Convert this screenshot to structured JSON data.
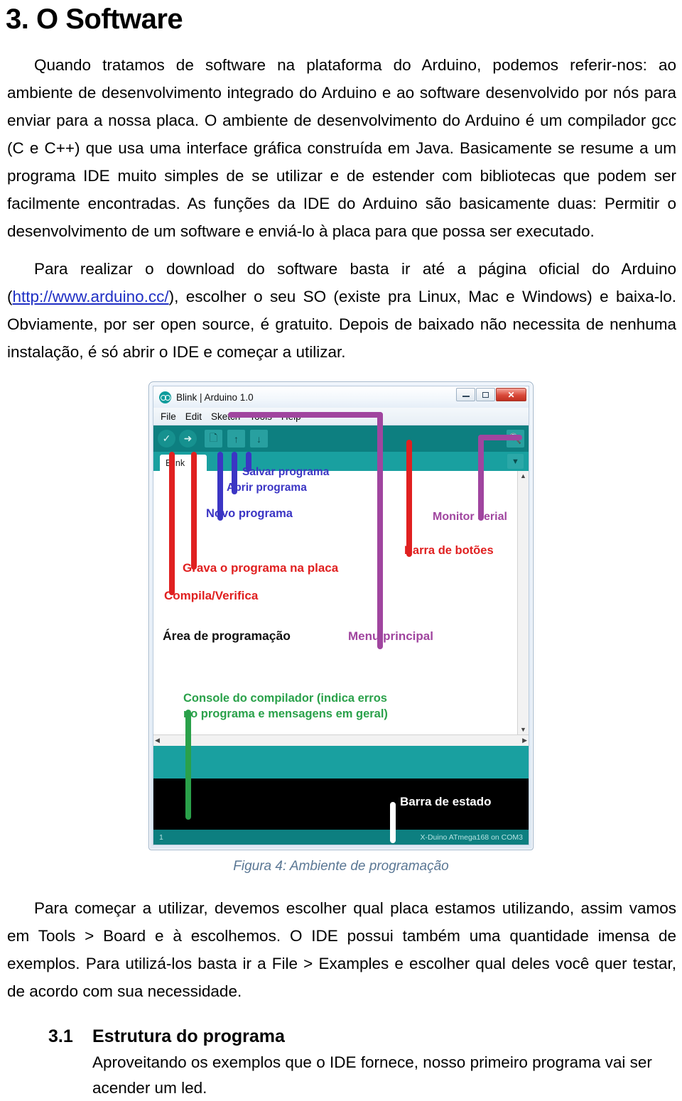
{
  "heading": "3. O Software",
  "paragraphs": {
    "p1": "Quando tratamos de software na plataforma do Arduino, podemos referir-nos: ao ambiente de desenvolvimento integrado do Arduino e ao software desenvolvido por nós para enviar para a nossa placa. O ambiente de desenvolvimento do Arduino é um compilador gcc (C e C++) que usa uma interface gráfica construída em Java. Basicamente se resume a um programa IDE muito simples de se utilizar e de estender com bibliotecas que podem ser facilmente encontradas. As funções da IDE do Arduino são basicamente duas: Permitir o desenvolvimento de um software e enviá-lo à placa para que possa ser executado.",
    "p2_before_link": "Para realizar o download do software basta ir até a página oficial do Arduino (",
    "p2_link": "http://www.arduino.cc/",
    "p2_after_link": "), escolher o seu SO (existe pra Linux, Mac e Windows) e baixa-lo. Obviamente, por ser open source, é gratuito.  Depois de baixado não necessita de nenhuma instalação, é só abrir o IDE e começar a utilizar.",
    "p3": "Para começar a utilizar, devemos escolher qual placa estamos utilizando, assim vamos em Tools > Board e à escolhemos. O IDE possui também uma quantidade imensa de exemplos. Para utilizá-los basta ir a File > Examples e escolher qual deles você quer testar, de acordo com sua necessidade."
  },
  "figure": {
    "caption": "Figura 4: Ambiente de programação",
    "ide": {
      "title": "Blink | Arduino 1.0",
      "logo_icon": "arduino-infinity-logo-icon",
      "window_buttons": {
        "minimize": "minimize-icon",
        "maximize": "maximize-icon",
        "close": "✕"
      },
      "menu": [
        "File",
        "Edit",
        "Sketch",
        "Tools",
        "Help"
      ],
      "toolbar": [
        {
          "name": "verify",
          "icon": "✓"
        },
        {
          "name": "upload",
          "icon": "➜"
        },
        {
          "name": "new",
          "icon": "🗋"
        },
        {
          "name": "open",
          "icon": "↑"
        },
        {
          "name": "save",
          "icon": "↓"
        },
        {
          "name": "serial-monitor",
          "icon": "🔍"
        }
      ],
      "tab_label": "Blink",
      "tab_dropdown_icon": "▼",
      "status_left": "1",
      "status_right": "X-Duino ATmega168 on COM3"
    },
    "annotations": [
      {
        "text": "Salvar programa",
        "color": "blue"
      },
      {
        "text": "Abrir programa",
        "color": "blue"
      },
      {
        "text": "Novo programa",
        "color": "blue"
      },
      {
        "text": "Monitor serial",
        "color": "purple"
      },
      {
        "text": "Barra de botões",
        "color": "red"
      },
      {
        "text": "Grava o programa na placa",
        "color": "red"
      },
      {
        "text": "Compila/Verifica",
        "color": "red"
      },
      {
        "text": "Área de programação",
        "color": "black"
      },
      {
        "text": "Menu principal",
        "color": "purple"
      },
      {
        "text": "Console do compilador (indica erros",
        "color": "green"
      },
      {
        "text": "no programa e mensagens em geral)",
        "color": "green"
      },
      {
        "text": "Barra de estado",
        "color": "white"
      }
    ],
    "colors": {
      "red": "#e02020",
      "blue": "#3b35c4",
      "purple": "#a0459f",
      "green": "#2aa14a",
      "white": "#ffffff",
      "teal_dark": "#0d7f80",
      "teal_light": "#19a0a0"
    }
  },
  "subsection": {
    "number": "3.1",
    "title": "Estrutura do programa",
    "body": "Aproveitando os exemplos que o IDE fornece, nosso primeiro programa vai ser acender um led."
  }
}
